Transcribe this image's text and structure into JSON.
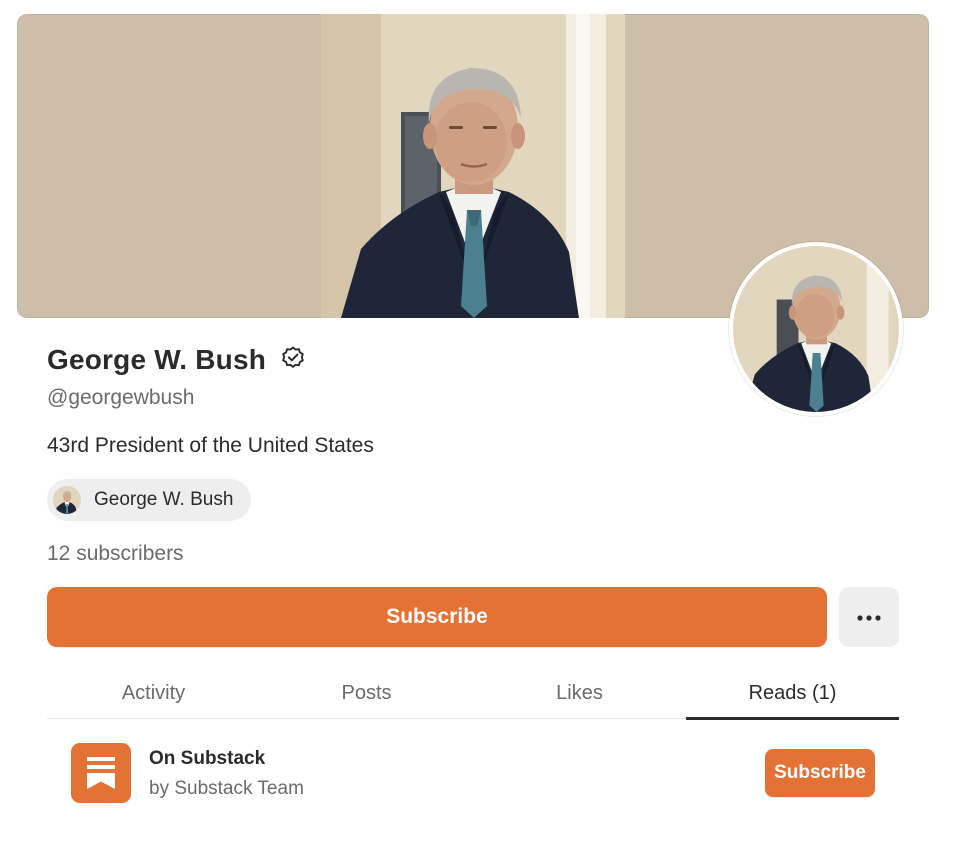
{
  "profile": {
    "name": "George W. Bush",
    "handle": "@georgewbush",
    "bio": "43rd President of the United States",
    "publication_chip": "George W. Bush",
    "subscriber_count": "12 subscribers",
    "verified_icon": "verified-check-icon"
  },
  "actions": {
    "subscribe_label": "Subscribe",
    "more_icon": "ellipsis-icon"
  },
  "tabs": [
    {
      "label": "Activity",
      "active": false
    },
    {
      "label": "Posts",
      "active": false
    },
    {
      "label": "Likes",
      "active": false
    },
    {
      "label": "Reads (1)",
      "active": true
    }
  ],
  "reads": [
    {
      "title": "On Substack",
      "author": "by Substack Team",
      "subscribe_label": "Subscribe",
      "logo_icon": "substack-logo-icon"
    }
  ],
  "colors": {
    "accent": "#e47234",
    "banner": "#cdbeaa",
    "text_primary": "#2b2b2b",
    "text_secondary": "#6b6b6b"
  }
}
